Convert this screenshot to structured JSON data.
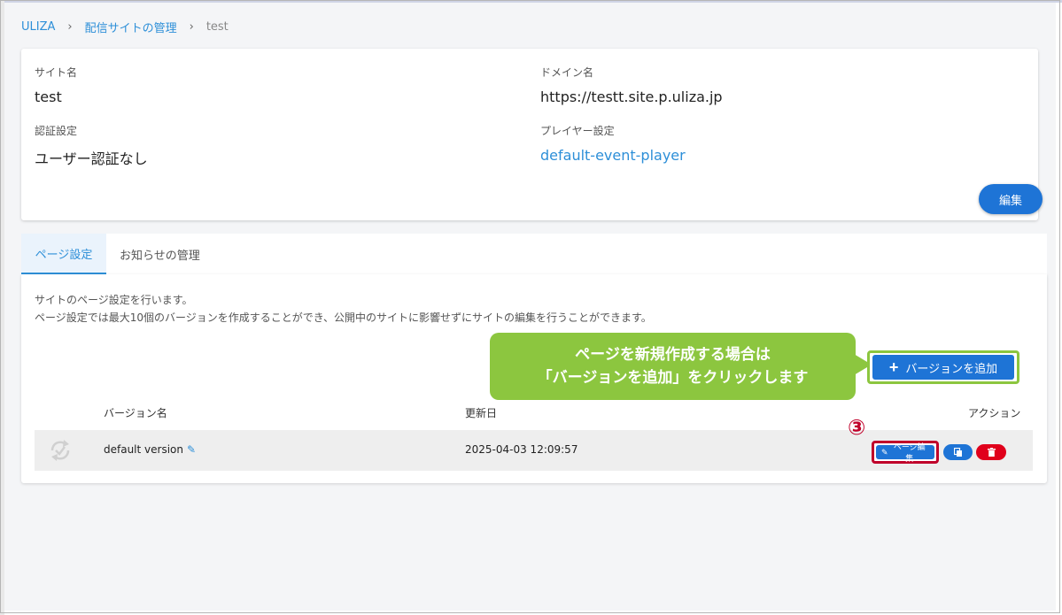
{
  "breadcrumb": {
    "root": "ULIZA",
    "parent": "配信サイトの管理",
    "current": "test",
    "separator": "›"
  },
  "site_info": {
    "site_name_label": "サイト名",
    "site_name_value": "test",
    "domain_label": "ドメイン名",
    "domain_value": "https://testt.site.p.uliza.jp",
    "auth_label": "認証設定",
    "auth_value": "ユーザー認証なし",
    "player_label": "プレイヤー設定",
    "player_value": "default-event-player",
    "edit_button": "編集"
  },
  "tabs": [
    {
      "label": "ページ設定",
      "active": true
    },
    {
      "label": "お知らせの管理",
      "active": false
    }
  ],
  "page_settings": {
    "desc_line1": "サイトのページ設定を行います。",
    "desc_line2": "ページ設定では最大10個のバージョンを作成することができ、公開中のサイトに影響せずにサイトの編集を行うことができます。",
    "add_version_button": "バージョンを追加",
    "columns": {
      "name": "バージョン名",
      "updated": "更新日",
      "actions": "アクション"
    },
    "rows": [
      {
        "name": "default version",
        "updated": "2025-04-03 12:09:57",
        "page_edit_button": "ページ編集"
      }
    ]
  },
  "annotation": {
    "callout_line1": "ページを新規作成する場合は",
    "callout_line2": "「バージョンを追加」をクリックします",
    "step_number": "③"
  },
  "colors": {
    "accent": "#1e74d6",
    "link": "#2d8fd8",
    "callout": "#8cc63f",
    "highlight": "#c0002a",
    "danger": "#e0001b"
  }
}
